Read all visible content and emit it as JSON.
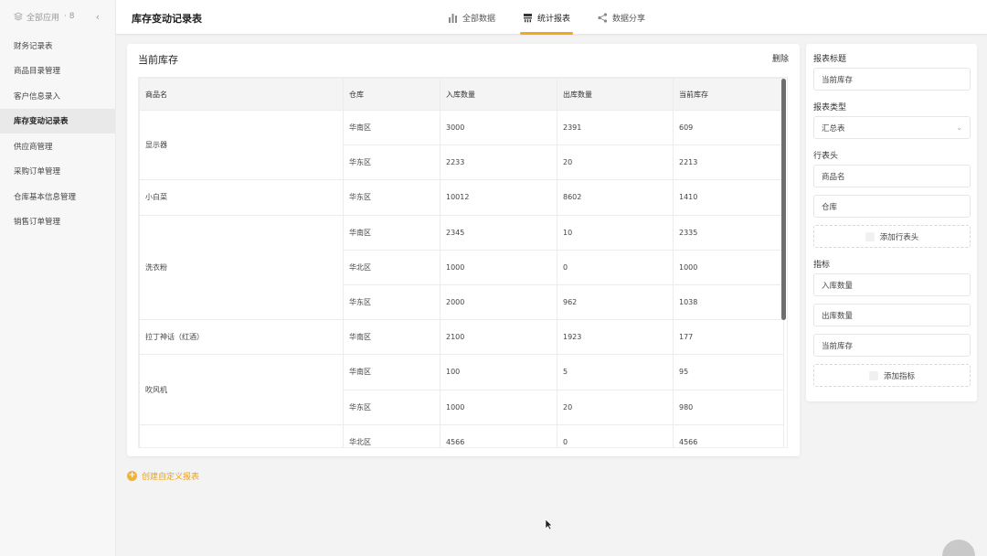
{
  "sidebar": {
    "header_label": "全部应用",
    "header_count": "· 8",
    "collapse_icon": "chevron-left-icon",
    "items": [
      {
        "label": "财务记录表"
      },
      {
        "label": "商品目录管理"
      },
      {
        "label": "客户信息录入"
      },
      {
        "label": "库存变动记录表",
        "active": true
      },
      {
        "label": "供应商管理"
      },
      {
        "label": "采购订单管理"
      },
      {
        "label": "仓库基本信息管理"
      },
      {
        "label": "销售订单管理"
      }
    ]
  },
  "header": {
    "title": "库存变动记录表",
    "tabs": [
      {
        "label": "全部数据",
        "icon": "bar-chart-icon"
      },
      {
        "label": "统计报表",
        "icon": "report-icon",
        "active": true
      },
      {
        "label": "数据分享",
        "icon": "share-icon"
      }
    ]
  },
  "report": {
    "title": "当前库存",
    "delete_label": "删除",
    "columns": [
      "商品名",
      "仓库",
      "入库数量",
      "出库数量",
      "当前库存"
    ],
    "rows": [
      {
        "name": "显示器",
        "rowspan": 2,
        "warehouse": "华南区",
        "in": "3000",
        "out": "2391",
        "stock": "609"
      },
      {
        "warehouse": "华东区",
        "in": "2233",
        "out": "20",
        "stock": "2213"
      },
      {
        "name": "小白菜",
        "rowspan": 1,
        "warehouse": "华东区",
        "in": "10012",
        "out": "8602",
        "stock": "1410"
      },
      {
        "name": "洗衣粉",
        "rowspan": 3,
        "warehouse": "华南区",
        "in": "2345",
        "out": "10",
        "stock": "2335"
      },
      {
        "warehouse": "华北区",
        "in": "1000",
        "out": "0",
        "stock": "1000"
      },
      {
        "warehouse": "华东区",
        "in": "2000",
        "out": "962",
        "stock": "1038"
      },
      {
        "name": "拉丁神话（红酒）",
        "rowspan": 1,
        "warehouse": "华南区",
        "in": "2100",
        "out": "1923",
        "stock": "177"
      },
      {
        "name": "吹风机",
        "rowspan": 2,
        "warehouse": "华南区",
        "in": "100",
        "out": "5",
        "stock": "95"
      },
      {
        "warehouse": "华东区",
        "in": "1000",
        "out": "20",
        "stock": "980"
      },
      {
        "name": "",
        "rowspan": 1,
        "warehouse": "华北区",
        "in": "4566",
        "out": "0",
        "stock": "4566"
      }
    ]
  },
  "create_report_label": "创建自定义报表",
  "panel": {
    "title_label": "报表标题",
    "title_value": "当前库存",
    "type_label": "报表类型",
    "type_value": "汇总表",
    "row_header_label": "行表头",
    "row_headers": [
      "商品名",
      "仓库"
    ],
    "add_row_header_label": "添加行表头",
    "metrics_label": "指标",
    "metrics": [
      "入库数量",
      "出库数量",
      "当前库存"
    ],
    "add_metric_label": "添加指标"
  },
  "colors": {
    "accent": "#f0a81c"
  }
}
